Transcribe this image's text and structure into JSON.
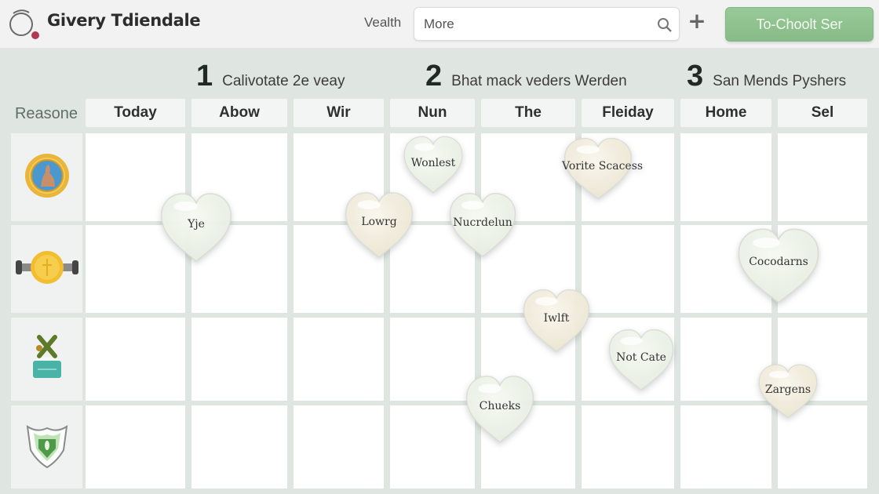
{
  "header": {
    "app_title": "Givery Tdiendale",
    "search_label": "Vealth",
    "search_value": "More",
    "add_label": "+",
    "cta_label": "To-Choolt Ser"
  },
  "steps": [
    {
      "number": "1",
      "text": "Calivotate 2e veay"
    },
    {
      "number": "2",
      "text": "Bhat mack veders Werden"
    },
    {
      "number": "3",
      "text": "San Mends Pyshers"
    }
  ],
  "grid": {
    "row_header_label": "Reasone",
    "columns": [
      "Today",
      "Abow",
      "Wir",
      "Nun",
      "The",
      "Fleiday",
      "Home",
      "Sel"
    ],
    "rows": [
      {
        "icon": "portrait-medallion-icon"
      },
      {
        "icon": "gold-coin-dumbbell-icon"
      },
      {
        "icon": "plant-box-icon"
      },
      {
        "icon": "green-shield-icon"
      }
    ]
  },
  "hearts": [
    {
      "label": "Yje",
      "tone": "mint"
    },
    {
      "label": "Wonlest",
      "tone": "mint"
    },
    {
      "label": "Vorite Scacess",
      "tone": "cream"
    },
    {
      "label": "Lowrg",
      "tone": "cream"
    },
    {
      "label": "Nucrdelun",
      "tone": "mint"
    },
    {
      "label": "Cocodarns",
      "tone": "mint"
    },
    {
      "label": "Iwlft",
      "tone": "cream"
    },
    {
      "label": "Not Cate",
      "tone": "mint"
    },
    {
      "label": "Chueks",
      "tone": "mint"
    },
    {
      "label": "Zargens",
      "tone": "cream"
    }
  ],
  "colors": {
    "accent_green": "#8fc28f",
    "background": "#dfe6e2",
    "heart_mint": "#eef3ea",
    "heart_cream": "#f6f1e3"
  }
}
